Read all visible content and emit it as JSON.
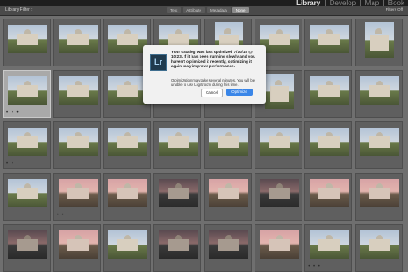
{
  "top_bar": {
    "modules": [
      "Library",
      "Develop",
      "Map",
      "Book"
    ],
    "active_module": "Library"
  },
  "filter_bar": {
    "title": "Library Filter :",
    "tabs": [
      "Text",
      "Attribute",
      "Metadata",
      "None"
    ],
    "active_tab": "None",
    "right_label": "Filters Off"
  },
  "dialog": {
    "title": "Your catalog was last optimized 7/10/15 @ 10:23. If it has been running slowly and you haven't optimized it recently, optimizing it again may improve performance.",
    "body": "Optimization may take several minutes. You will be unable to use Lightroom during this time.",
    "cancel_label": "Cancel",
    "optimize_label": "Optimize",
    "icon": "Lr"
  },
  "grid": {
    "rows": [
      [
        {
          "style": "day"
        },
        {
          "style": "day"
        },
        {
          "style": "day"
        },
        {
          "style": "day"
        },
        {
          "style": "tall"
        },
        {
          "style": "day"
        },
        {
          "style": "day"
        },
        {
          "style": "tall"
        }
      ],
      [
        {
          "style": "day",
          "selected": true,
          "dots": "• • •"
        },
        {
          "style": "day"
        },
        {
          "style": "day"
        },
        {
          "style": "hidden"
        },
        {
          "style": "hidden"
        },
        {
          "style": "tall"
        },
        {
          "style": "day"
        },
        {
          "style": "day"
        }
      ],
      [
        {
          "style": "day",
          "dots": "• •"
        },
        {
          "style": "day"
        },
        {
          "style": "day"
        },
        {
          "style": "day"
        },
        {
          "style": "day"
        },
        {
          "style": "day"
        },
        {
          "style": "day"
        },
        {
          "style": "day"
        }
      ],
      [
        {
          "style": "day"
        },
        {
          "style": "pink",
          "dots": "• •"
        },
        {
          "style": "pink"
        },
        {
          "style": "dusk"
        },
        {
          "style": "pink"
        },
        {
          "style": "dusk"
        },
        {
          "style": "pink"
        },
        {
          "style": "pink"
        }
      ],
      [
        {
          "style": "dusk"
        },
        {
          "style": "pink"
        },
        {
          "style": "day"
        },
        {
          "style": "dusk"
        },
        {
          "style": "dusk"
        },
        {
          "style": "pink"
        },
        {
          "style": "day",
          "dots": "• • •"
        },
        {
          "style": "day"
        }
      ]
    ]
  }
}
